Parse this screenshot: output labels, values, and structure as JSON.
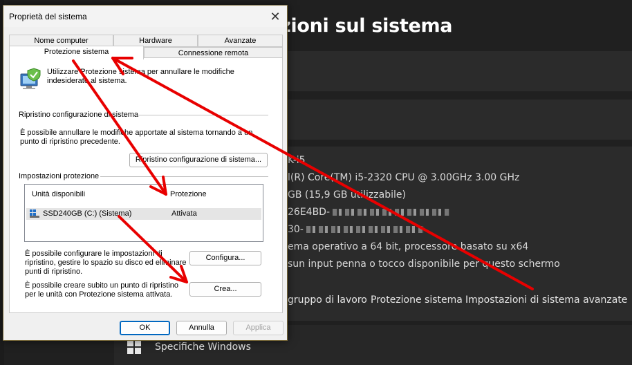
{
  "background": {
    "page_title": "zioni sul sistema",
    "info_lines": [
      {
        "text": "K-i5",
        "masked": false
      },
      {
        "text": "l(R) Core(TM) i5-2320 CPU @ 3.00GHz   3.00 GHz",
        "masked": false
      },
      {
        "text": "GB (15,9 GB utilizzabile)",
        "masked": false
      },
      {
        "text": "26E4BD-",
        "masked": true
      },
      {
        "text": "30-",
        "masked": true
      },
      {
        "text": "ema operativo a 64 bit, processore basato su x64",
        "masked": false
      },
      {
        "text": "sun input penna o tocco disponibile per questo schermo",
        "masked": false
      }
    ],
    "links": {
      "workgroup": "gruppo di lavoro",
      "system_protection": "Protezione sistema",
      "advanced_settings": "Impostazioni di sistema avanzate"
    },
    "footer": "Specifiche Windows"
  },
  "dialog": {
    "title": "Proprietà del sistema",
    "close_glyph": "✕",
    "tabs_row1": [
      "Nome computer",
      "Hardware",
      "Avanzate"
    ],
    "tabs_row2": [
      "Protezione sistema",
      "Connessione remota"
    ],
    "intro": "Utilizzare Protezione sistema per annullare le modifiche indesiderate al sistema.",
    "restore_section": "Ripristino configurazione di sistema",
    "restore_desc": "È possibile annullare le modifiche apportate al sistema tornando a un punto di ripristino precedente.",
    "restore_button": "Ripristino configurazione di sistema...",
    "protection_section": "Impostazioni protezione",
    "list_headers": [
      "Unità disponibili",
      "Protezione"
    ],
    "drive_name": "SSD240GB (C:) (Sistema)",
    "drive_status": "Attivata",
    "configure_desc": "È possibile configurare le impostazioni di ripristino, gestire lo spazio su disco ed eliminare punti di ripristino.",
    "configure_button": "Configura...",
    "create_desc": "È possibile creare subito un punto di ripristino per le unità con Protezione sistema attivata.",
    "create_button": "Crea...",
    "ok": "OK",
    "cancel": "Annulla",
    "apply": "Applica"
  },
  "colors": {
    "annotation": "#e80000",
    "dark_bg": "#202020",
    "link_blue": "#0067c0"
  },
  "icons": {
    "protection": "computer-shield-icon",
    "drive": "drive-icon",
    "windows": "windows-logo-icon"
  }
}
